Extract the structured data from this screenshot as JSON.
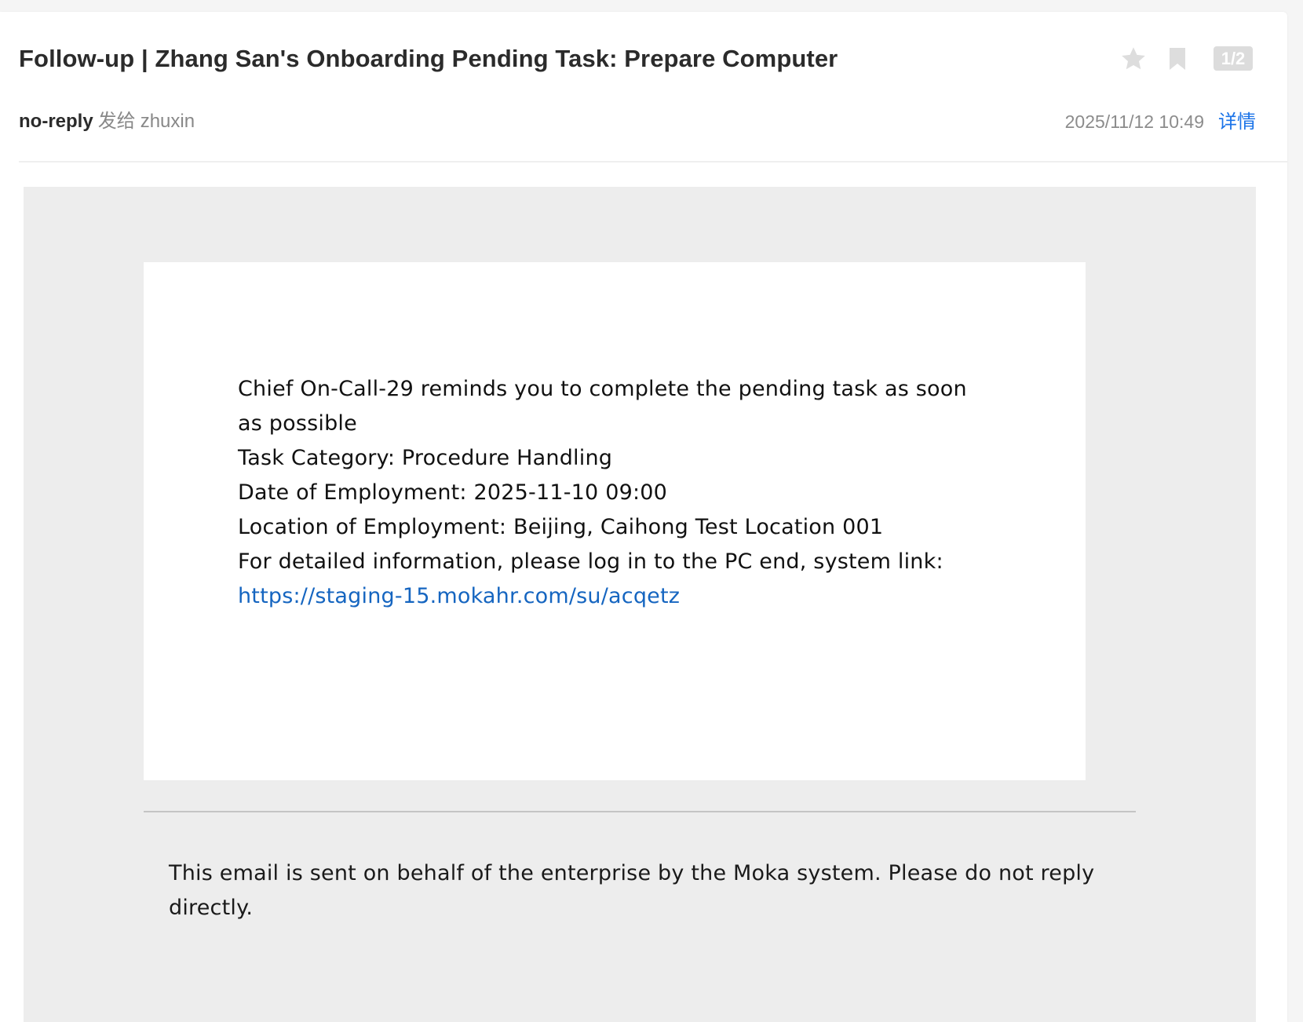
{
  "header": {
    "subject": "Follow-up | Zhang San's Onboarding Pending Task: Prepare Computer",
    "sender": "no-reply",
    "to_word": "发给",
    "recipient": "zhuxin",
    "datetime": "2025/11/12  10:49",
    "details_label": "详情",
    "page_indicator": "1/2",
    "icons": [
      "star-icon",
      "bookmark-icon"
    ]
  },
  "body": {
    "line_reminder": "Chief On-Call-29 reminds you to complete the pending task as soon as possible",
    "line_category": "Task Category: Procedure Handling",
    "line_date": "Date of Employment: 2025-11-10 09:00",
    "line_location": "Location of Employment: Beijing, Caihong Test Location 001",
    "line_info": "For detailed information, please log in to the PC end, system link:",
    "link_url": "https://staging-15.mokahr.com/su/acqetz"
  },
  "footer": {
    "note": "This email is sent on behalf of the enterprise by the Moka system. Please do not reply directly."
  },
  "colors": {
    "accent_link": "#1a73e8",
    "body_link": "#1565c0",
    "body_background": "#ededed",
    "icon_gray": "#dcdcdc"
  }
}
